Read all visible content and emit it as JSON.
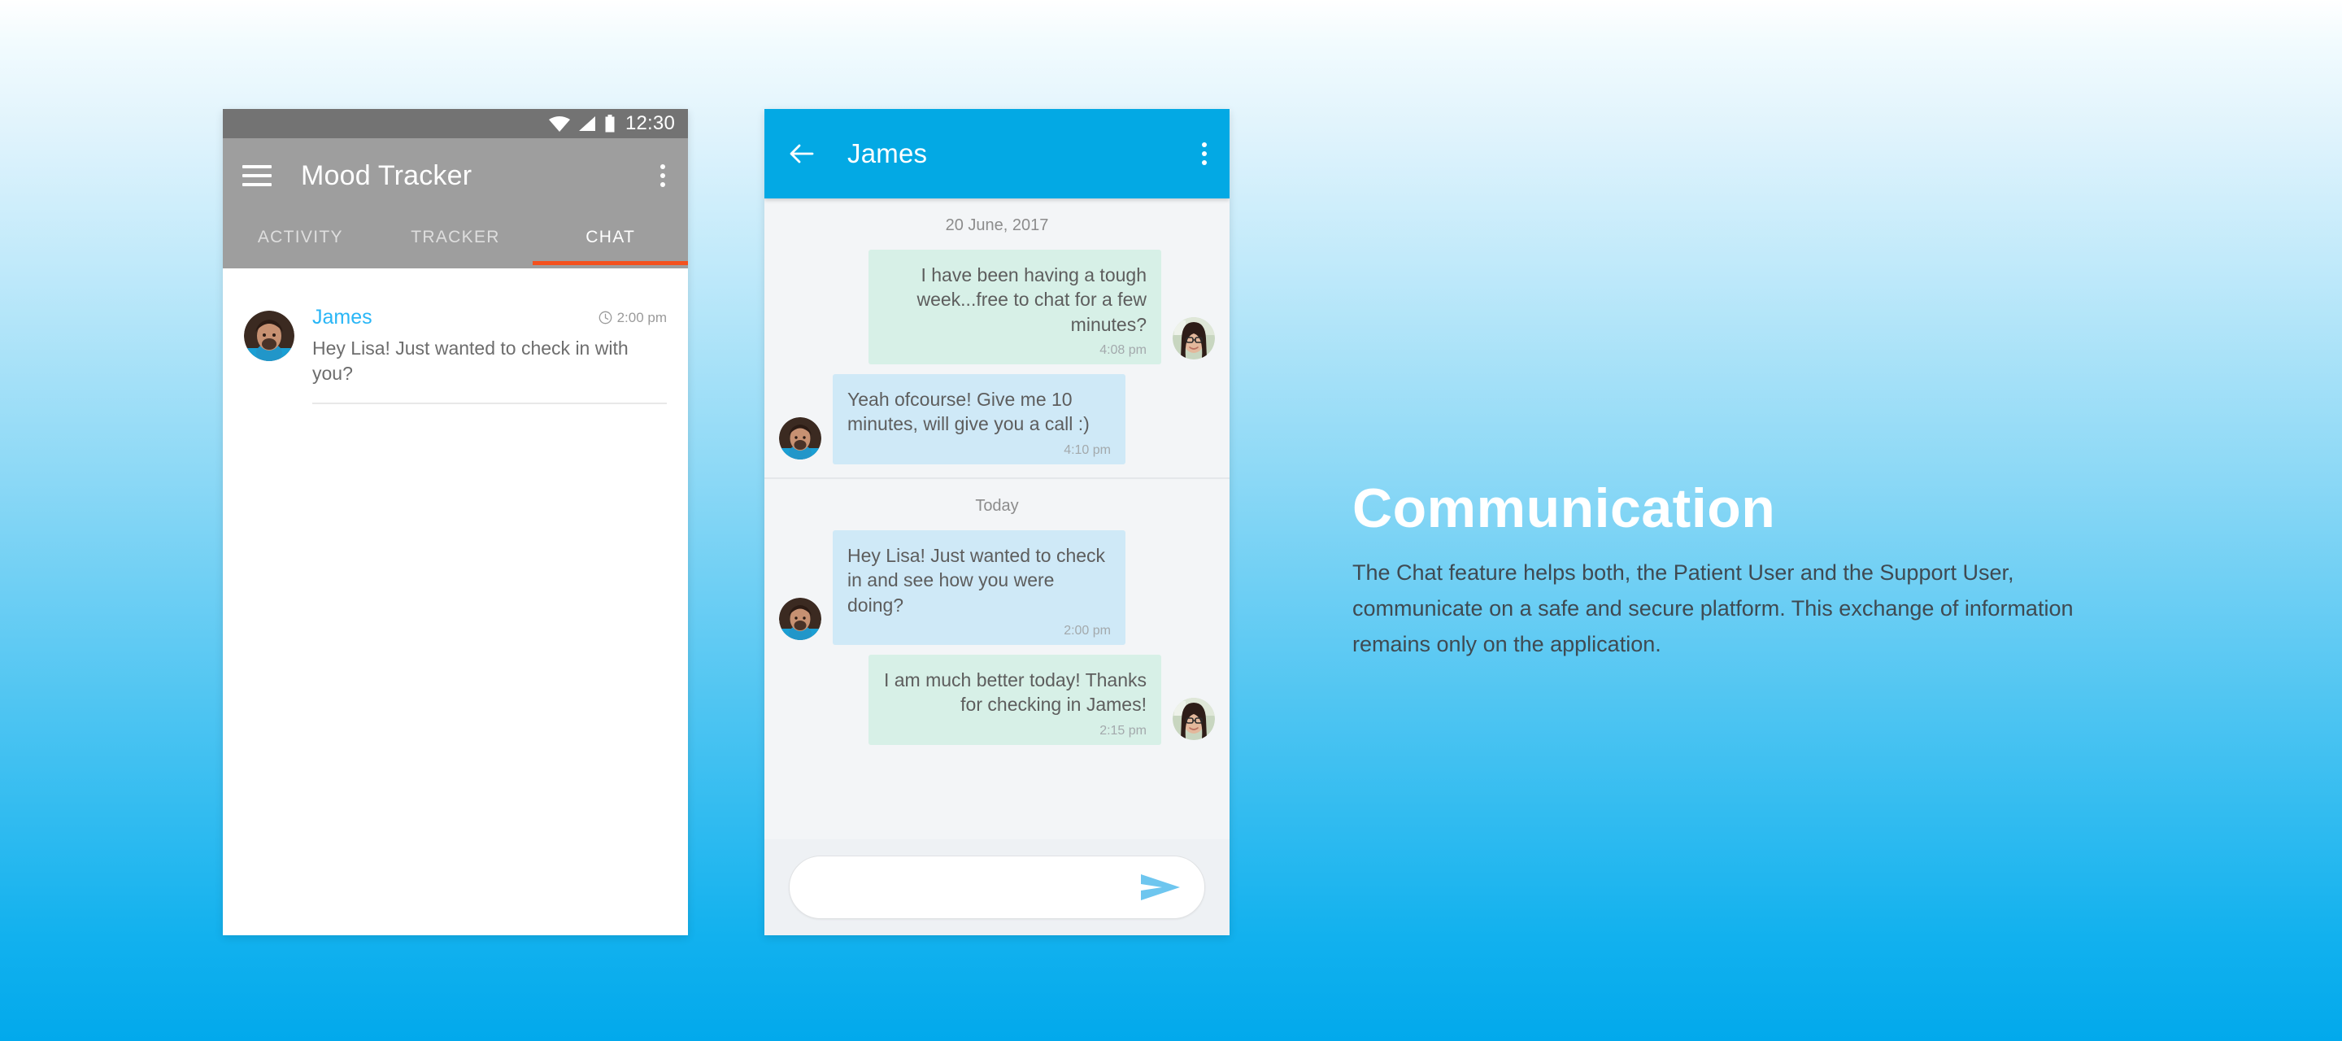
{
  "background": {
    "gradient_top": "#ffffff",
    "gradient_bottom": "#02a9ec"
  },
  "phone_list": {
    "status_bar": {
      "time": "12:30",
      "icons": [
        "wifi-icon",
        "signal-icon",
        "battery-icon"
      ],
      "background": "#737373"
    },
    "app_bar": {
      "menu_icon": "hamburger-icon",
      "title": "Mood Tracker",
      "overflow_icon": "overflow-menu-icon",
      "background": "#9e9e9e"
    },
    "tabs": [
      {
        "label": "ACTIVITY",
        "active": false
      },
      {
        "label": "TRACKER",
        "active": false
      },
      {
        "label": "CHAT",
        "active": true
      }
    ],
    "tab_indicator_color": "#f4511e",
    "conversations": [
      {
        "avatar": "james-avatar",
        "name": "James",
        "name_color": "#29b6f6",
        "time_icon": "clock-icon",
        "time": "2:00 pm",
        "preview": "Hey Lisa! Just wanted to check in with you?"
      }
    ]
  },
  "phone_thread": {
    "app_bar": {
      "back_icon": "back-arrow-icon",
      "title": "James",
      "overflow_icon": "overflow-menu-icon",
      "background": "#03A9E4"
    },
    "day_groups": [
      {
        "date_label": "20 June, 2017",
        "messages": [
          {
            "direction": "out",
            "sender": "lisa",
            "avatar": "lisa-avatar",
            "text": "I have been having a tough week...free to chat for a few minutes?",
            "time": "4:08 pm",
            "bubble_color": "#d7f0e7"
          },
          {
            "direction": "in",
            "sender": "james",
            "avatar": "james-avatar",
            "text": "Yeah ofcourse! Give me 10 minutes, will give you a call :)",
            "time": "4:10 pm",
            "bubble_color": "#cfe9f7"
          }
        ]
      },
      {
        "date_label": "Today",
        "messages": [
          {
            "direction": "in",
            "sender": "james",
            "avatar": "james-avatar",
            "text": "Hey Lisa! Just wanted to check in and see how you were doing?",
            "time": "2:00 pm",
            "bubble_color": "#cfe9f7"
          },
          {
            "direction": "out",
            "sender": "lisa",
            "avatar": "lisa-avatar",
            "text": "I am much better today! Thanks for checking in James!",
            "time": "2:15 pm",
            "bubble_color": "#d7f0e7"
          }
        ]
      }
    ],
    "composer": {
      "value": "",
      "placeholder": "",
      "send_icon": "send-icon",
      "send_color": "#6ec6ef"
    }
  },
  "copy": {
    "title": "Communication",
    "body": "The Chat feature helps both, the Patient User and the Support User, communicate on a safe and secure platform. This exchange of information remains only on the application."
  }
}
